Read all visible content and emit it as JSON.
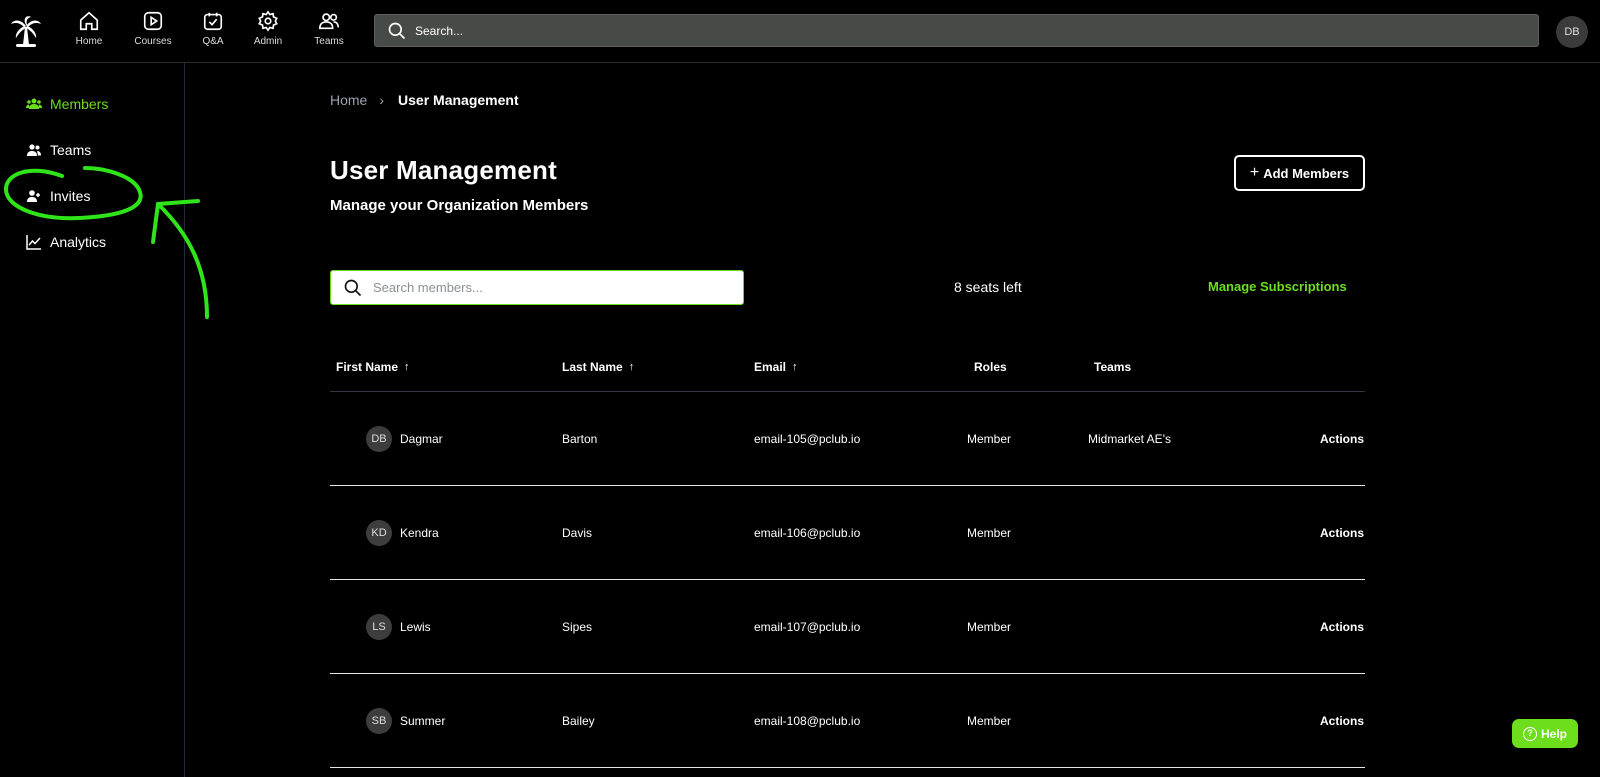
{
  "topnav": {
    "items": [
      {
        "label": "Home",
        "icon": "home-icon"
      },
      {
        "label": "Courses",
        "icon": "play-icon"
      },
      {
        "label": "Q&A",
        "icon": "calendar-check-icon"
      },
      {
        "label": "Admin",
        "icon": "gear-icon"
      },
      {
        "label": "Teams",
        "icon": "users-icon"
      }
    ],
    "search_placeholder": "Search...",
    "avatar_initials": "DB"
  },
  "sidebar": {
    "items": [
      {
        "label": "Members",
        "icon": "paw-users-icon",
        "active": true
      },
      {
        "label": "Teams",
        "icon": "users-icon",
        "active": false
      },
      {
        "label": "Invites",
        "icon": "user-plus-icon",
        "active": false
      },
      {
        "label": "Analytics",
        "icon": "line-chart-icon",
        "active": false
      }
    ]
  },
  "breadcrumb": {
    "home": "Home",
    "current": "User Management"
  },
  "page": {
    "title": "User Management",
    "subtitle": "Manage your Organization Members",
    "add_button": "Add Members",
    "search_placeholder": "Search members...",
    "seats_left": "8 seats left",
    "manage_subscriptions": "Manage Subscriptions"
  },
  "table": {
    "headers": [
      "First Name",
      "Last Name",
      "Email",
      "Roles",
      "Teams"
    ],
    "sort_arrow": "↑",
    "rows": [
      {
        "initials": "DB",
        "first": "Dagmar",
        "last": "Barton",
        "email": "email-105@pclub.io",
        "role": "Member",
        "team": "Midmarket AE's",
        "action": "Actions"
      },
      {
        "initials": "KD",
        "first": "Kendra",
        "last": "Davis",
        "email": "email-106@pclub.io",
        "role": "Member",
        "team": "",
        "action": "Actions"
      },
      {
        "initials": "LS",
        "first": "Lewis",
        "last": "Sipes",
        "email": "email-107@pclub.io",
        "role": "Member",
        "team": "",
        "action": "Actions"
      },
      {
        "initials": "SB",
        "first": "Summer",
        "last": "Bailey",
        "email": "email-108@pclub.io",
        "role": "Member",
        "team": "",
        "action": "Actions"
      }
    ]
  },
  "help": {
    "label": "Help",
    "icon_glyph": "?"
  },
  "colors": {
    "accent": "#6cde1c",
    "background": "#000000",
    "search_bg": "#474b47"
  }
}
